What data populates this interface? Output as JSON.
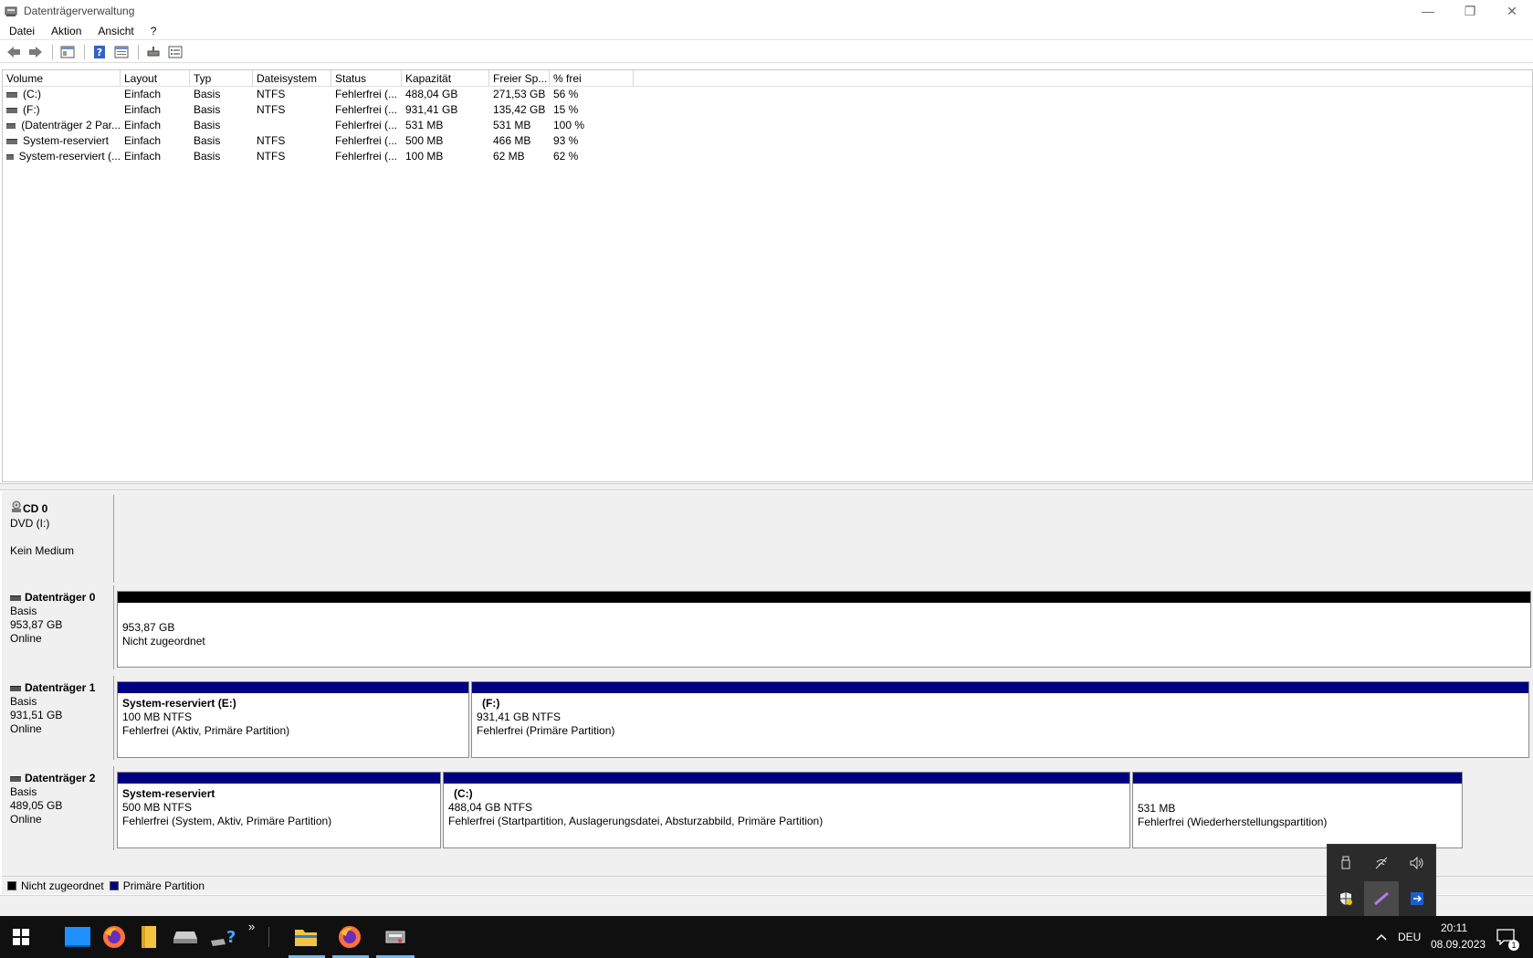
{
  "window": {
    "title": "Datenträgerverwaltung",
    "minimize": "—",
    "restore": "❐",
    "close": "✕"
  },
  "menu": [
    "Datei",
    "Aktion",
    "Ansicht",
    "?"
  ],
  "toolbar": {
    "icons": [
      "back-icon",
      "forward-icon",
      "console-tree-icon",
      "help-icon",
      "properties-icon",
      "rescan-icon",
      "list-view-icon"
    ]
  },
  "volume_table": {
    "columns": [
      "Volume",
      "Layout",
      "Typ",
      "Dateisystem",
      "Status",
      "Kapazität",
      "Freier Sp...",
      "% frei"
    ],
    "rows": [
      [
        "(C:)",
        "Einfach",
        "Basis",
        "NTFS",
        "Fehlerfrei (...",
        "488,04 GB",
        "271,53 GB",
        "56 %"
      ],
      [
        "(F:)",
        "Einfach",
        "Basis",
        "NTFS",
        "Fehlerfrei (...",
        "931,41 GB",
        "135,42 GB",
        "15 %"
      ],
      [
        "(Datenträger 2 Par...",
        "Einfach",
        "Basis",
        "",
        "Fehlerfrei (...",
        "531 MB",
        "531 MB",
        "100 %"
      ],
      [
        "System-reserviert",
        "Einfach",
        "Basis",
        "NTFS",
        "Fehlerfrei (...",
        "500 MB",
        "466 MB",
        "93 %"
      ],
      [
        "System-reserviert (...",
        "Einfach",
        "Basis",
        "NTFS",
        "Fehlerfrei (...",
        "100 MB",
        "62 MB",
        "62 %"
      ]
    ]
  },
  "disks": {
    "cd0": {
      "name": "CD 0",
      "line1": "DVD (I:)",
      "line2": "Kein Medium"
    },
    "d0": {
      "name": "Datenträger 0",
      "type": "Basis",
      "size": "953,87 GB",
      "state": "Online",
      "p0": {
        "size": "953,87 GB",
        "desc": "Nicht zugeordnet"
      }
    },
    "d1": {
      "name": "Datenträger 1",
      "type": "Basis",
      "size": "931,51 GB",
      "state": "Online",
      "p0": {
        "name": "System-reserviert  (E:)",
        "size": "100 MB NTFS",
        "desc": "Fehlerfrei (Aktiv, Primäre Partition)"
      },
      "p1": {
        "name": "(F:)",
        "size": "931,41 GB NTFS",
        "desc": "Fehlerfrei (Primäre Partition)"
      }
    },
    "d2": {
      "name": "Datenträger 2",
      "type": "Basis",
      "size": "489,05 GB",
      "state": "Online",
      "p0": {
        "name": "System-reserviert",
        "size": "500 MB NTFS",
        "desc": "Fehlerfrei (System, Aktiv, Primäre Partition)"
      },
      "p1": {
        "name": "(C:)",
        "size": "488,04 GB NTFS",
        "desc": "Fehlerfrei (Startpartition, Auslagerungsdatei, Absturzabbild, Primäre Partition)"
      },
      "p2": {
        "size": "531 MB",
        "desc": "Fehlerfrei (Wiederherstellungspartition)"
      }
    }
  },
  "legend": {
    "unallocated": "Nicht zugeordnet",
    "primary": "Primäre Partition",
    "colors": {
      "unallocated": "#000000",
      "primary": "#000080"
    }
  },
  "taskbar": {
    "language": "DEU",
    "time": "20:11",
    "date": "08.09.2023",
    "notification_count": "1",
    "overflow": "»"
  }
}
